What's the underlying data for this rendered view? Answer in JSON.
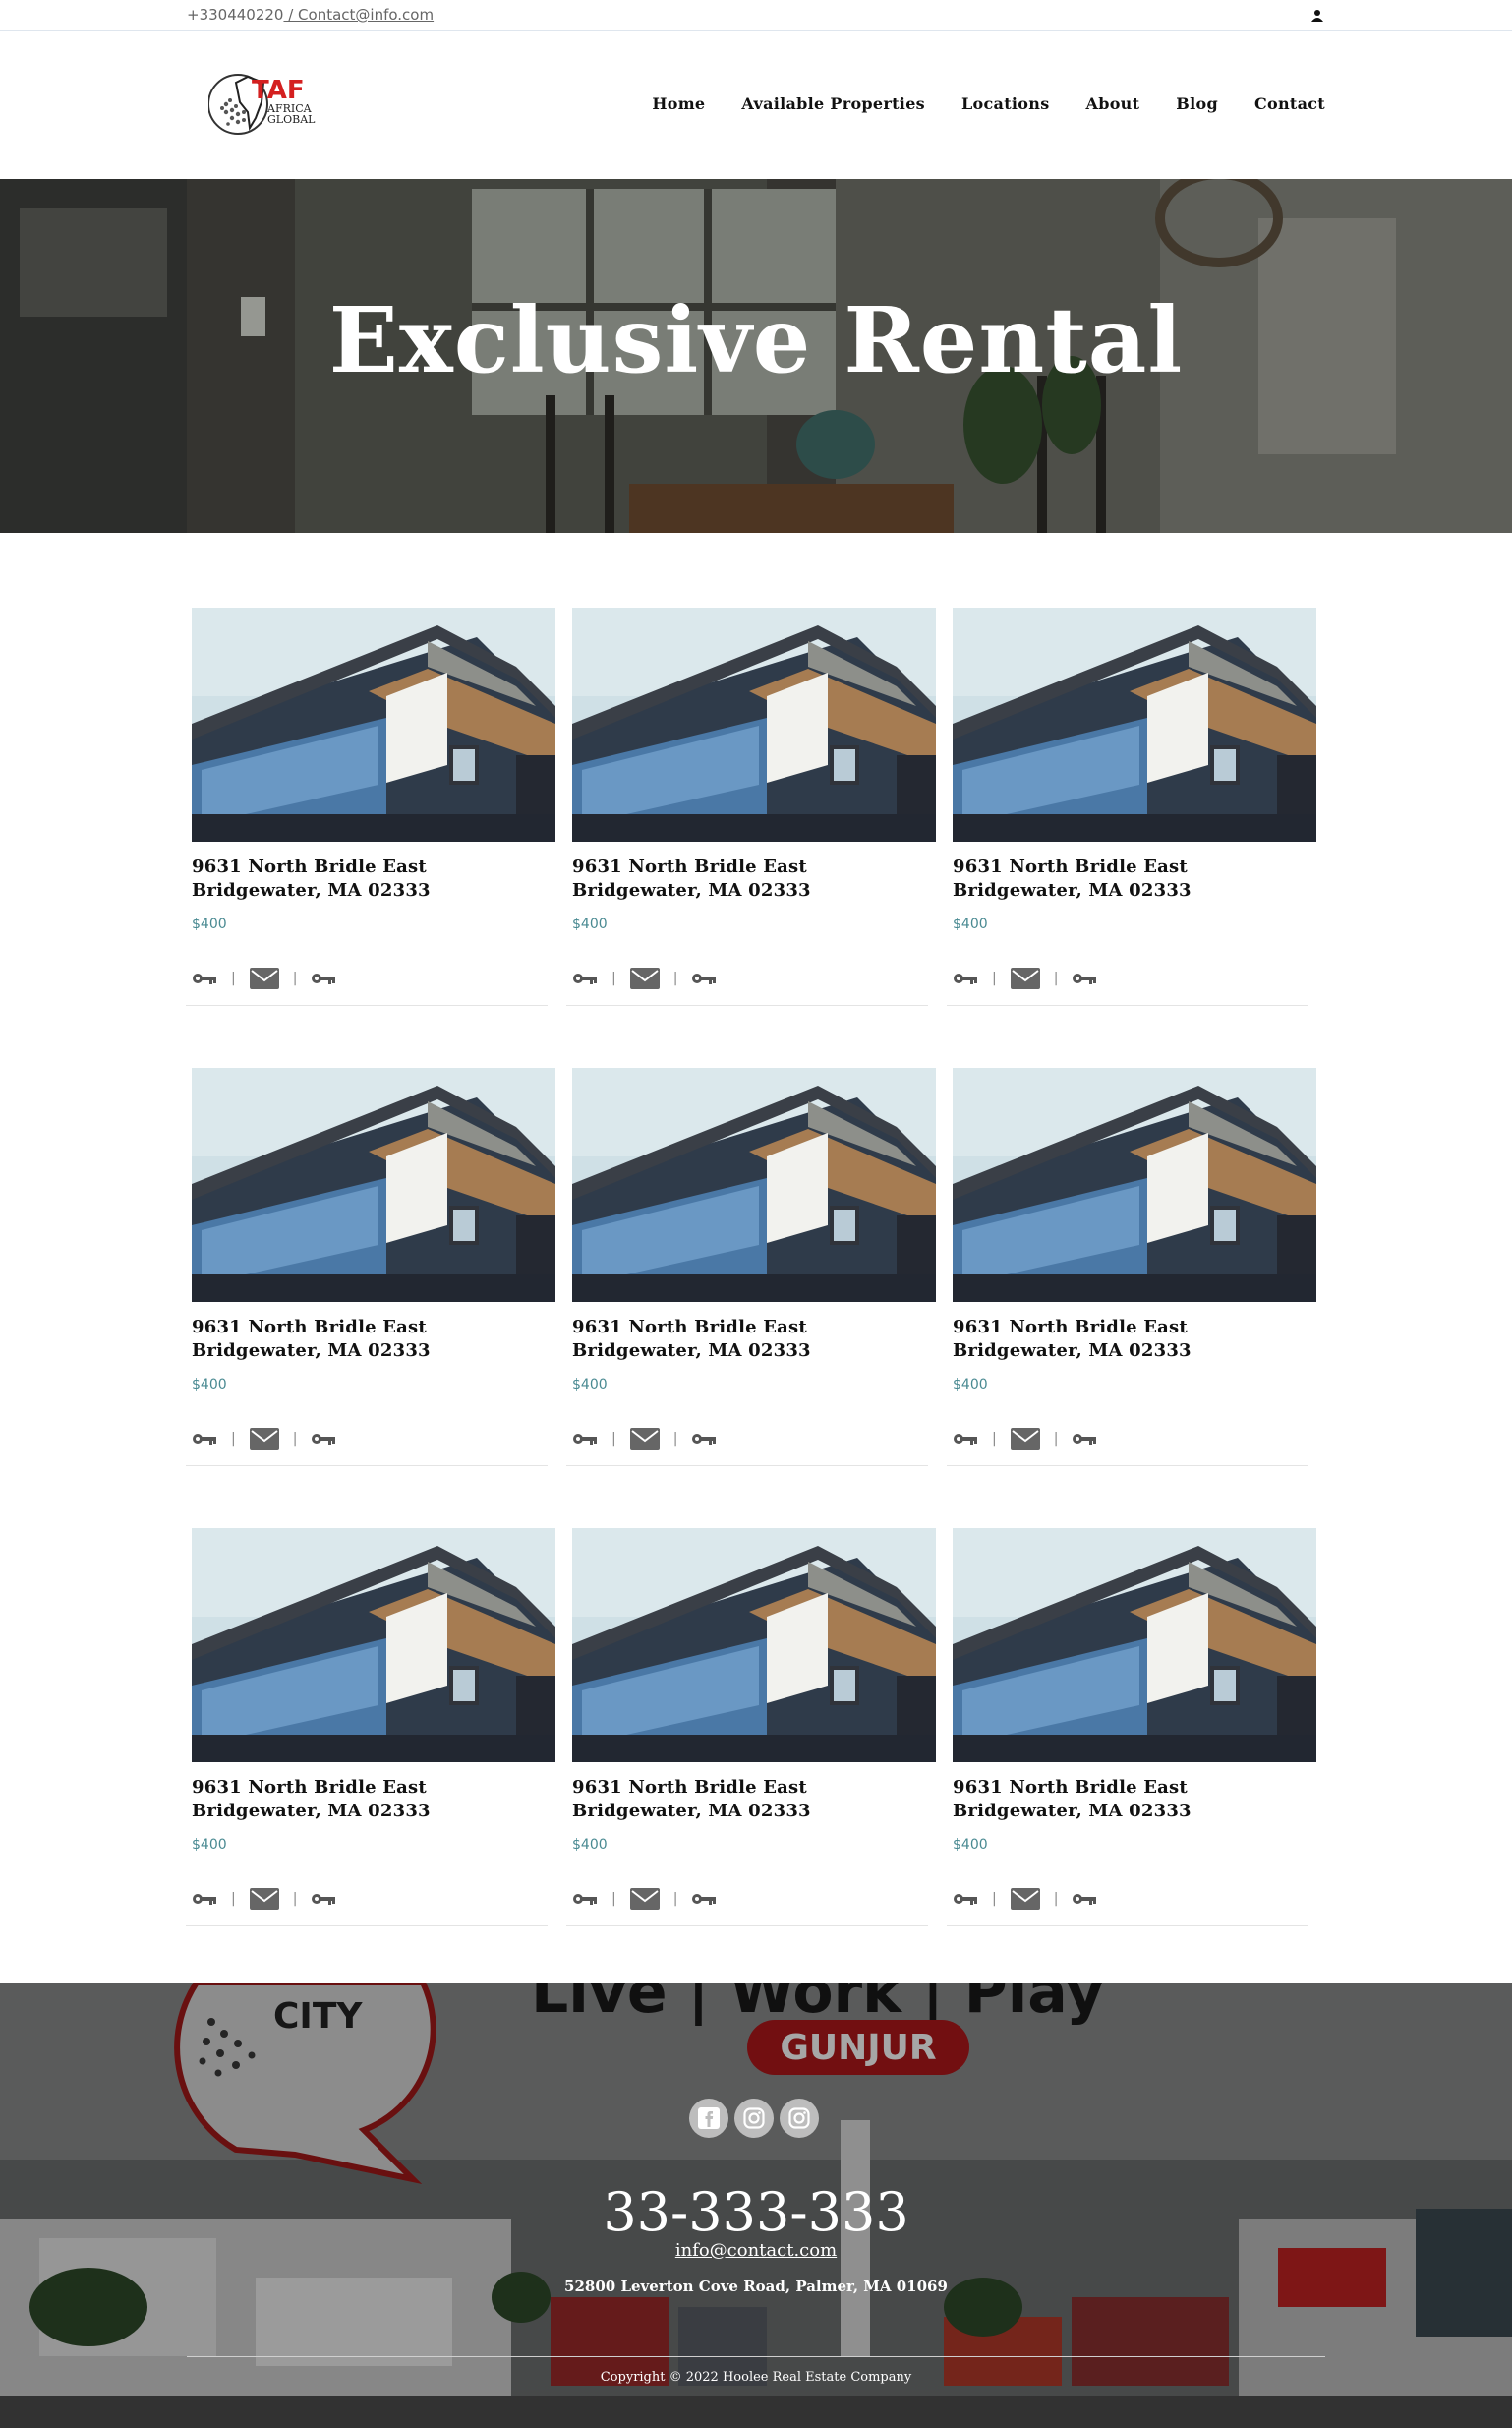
{
  "topbar": {
    "phone": "+330440220",
    "email_link": " / Contact@info.com"
  },
  "header": {
    "logo_text_main": "TAF",
    "logo_text_sub1": "AFRICA",
    "logo_text_sub2": "GLOBAL",
    "nav": [
      "Home",
      "Available Properties",
      "Locations",
      "About",
      "Blog",
      "Contact"
    ]
  },
  "hero": {
    "title": "Exclusive Rental"
  },
  "listings": [
    {
      "address": "9631 North Bridle East Bridgewater, MA 02333",
      "price": "$400"
    },
    {
      "address": "9631 North Bridle East Bridgewater, MA 02333",
      "price": "$400"
    },
    {
      "address": "9631 North Bridle East Bridgewater, MA 02333",
      "price": "$400"
    },
    {
      "address": "9631 North Bridle East Bridgewater, MA 02333",
      "price": "$400"
    },
    {
      "address": "9631 North Bridle East Bridgewater, MA 02333",
      "price": "$400"
    },
    {
      "address": "9631 North Bridle East Bridgewater, MA 02333",
      "price": "$400"
    },
    {
      "address": "9631 North Bridle East Bridgewater, MA 02333",
      "price": "$400"
    },
    {
      "address": "9631 North Bridle East Bridgewater, MA 02333",
      "price": "$400"
    },
    {
      "address": "9631 North Bridle East Bridgewater, MA 02333",
      "price": "$400"
    }
  ],
  "card_icons": [
    "key-icon",
    "mail-icon",
    "key-icon"
  ],
  "card_separator": "|",
  "footer": {
    "banner_text_1": "Live | Work | Play",
    "banner_text_2": "GUNJUR",
    "banner_logo_text": "CITY",
    "social": [
      "facebook-icon",
      "instagram-icon",
      "instagram-icon"
    ],
    "phone": "33-333-333",
    "email": "info@contact.com",
    "address": "52800 Leverton Cove Road, Palmer, MA 01069",
    "copyright": "Copyright © 2022 Hoolee Real Estate Company"
  },
  "colors": {
    "accent_price": "#4a8a92",
    "logo_red": "#d42020",
    "banner_red": "#b0171b"
  }
}
